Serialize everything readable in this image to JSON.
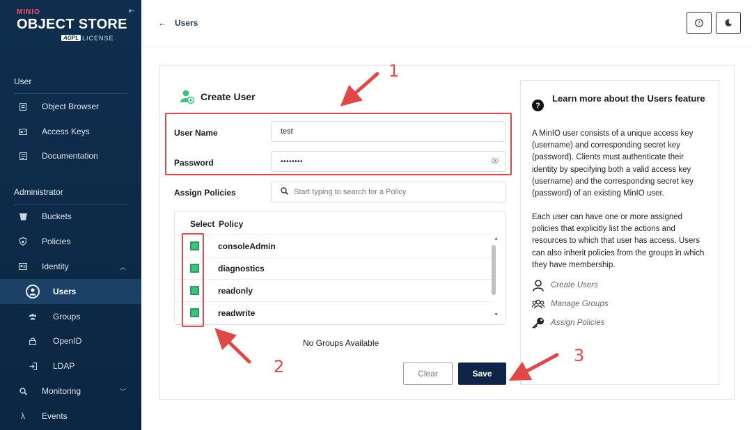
{
  "sidebar": {
    "logo": {
      "brand": "MINIO",
      "product": "OBJECT STORE",
      "badge": "AGPL",
      "license": "LICENSE"
    },
    "sections": [
      {
        "title": "User"
      },
      {
        "title": "Administrator"
      }
    ],
    "items": [
      {
        "label": "Object Browser",
        "icon": "browser-icon"
      },
      {
        "label": "Access Keys",
        "icon": "key-card-icon"
      },
      {
        "label": "Documentation",
        "icon": "document-icon"
      },
      {
        "label": "Buckets",
        "icon": "bucket-icon"
      },
      {
        "label": "Policies",
        "icon": "shield-icon"
      },
      {
        "label": "Identity",
        "icon": "id-card-icon"
      },
      {
        "label": "Users",
        "icon": "user-icon"
      },
      {
        "label": "Groups",
        "icon": "group-icon"
      },
      {
        "label": "OpenID",
        "icon": "lock-icon"
      },
      {
        "label": "LDAP",
        "icon": "login-icon"
      },
      {
        "label": "Monitoring",
        "icon": "magnifier-icon"
      },
      {
        "label": "Events",
        "icon": "lambda-icon"
      }
    ]
  },
  "header": {
    "back_label": "Users"
  },
  "form": {
    "title": "Create User",
    "username_label": "User Name",
    "username_value": "test",
    "password_label": "Password",
    "password_value": "••••••••",
    "policies_label": "Assign Policies",
    "search_placeholder": "Start typing to search for a Policy",
    "table": {
      "headers": [
        "Select",
        "Policy"
      ],
      "rows": [
        {
          "name": "consoleAdmin",
          "checked": true
        },
        {
          "name": "diagnostics",
          "checked": true
        },
        {
          "name": "readonly",
          "checked": true
        },
        {
          "name": "readwrite",
          "checked": true
        }
      ]
    },
    "no_groups": "No Groups Available",
    "clear_label": "Clear",
    "save_label": "Save"
  },
  "help": {
    "title": "Learn more about the Users feature",
    "para1": "A MinIO user consists of a unique access key (username) and corresponding secret key (password). Clients must authenticate their identity by specifying both a valid access key (username) and the corresponding secret key (password) of an existing MinIO user.",
    "para2": "Each user can have one or more assigned policies that explicitly list the actions and resources to which that user has access. Users can also inherit policies from the groups in which they have membership.",
    "links": [
      {
        "label": "Create Users",
        "icon": "user-icon"
      },
      {
        "label": "Manage Groups",
        "icon": "group-icon"
      },
      {
        "label": "Assign Policies",
        "icon": "key-icon"
      }
    ]
  },
  "annotations": [
    "1",
    "2",
    "3"
  ],
  "colors": {
    "sidebar_bg": "#0f2e4e",
    "accent_red": "#e04848",
    "checkbox_green": "#3bc47e",
    "save_bg": "#0f2446"
  }
}
